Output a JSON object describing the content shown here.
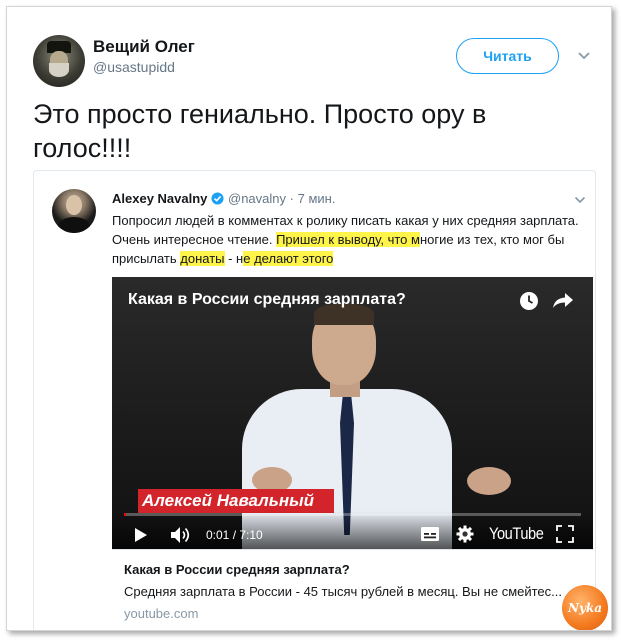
{
  "author": {
    "display_name": "Вещий Олег",
    "handle": "@usastupidd",
    "avatar_icon": "avatar-portrait",
    "follow_label": "Читать"
  },
  "tweet": {
    "text_line1": "Это просто гениально. Просто ору в",
    "text_line2": "голос!!!!"
  },
  "quoted": {
    "name": "Alexey Navalny",
    "handle": "@navalny",
    "separator": "·",
    "time": "7 мин.",
    "text_part1": "Попросил людей в комментах к ролику писать какая у них средняя зарплата. Очень интересное чтение. ",
    "text_hl1": "Пришел к выводу, что м",
    "text_part2": "ногие из тех, кто мог бы присылать ",
    "text_hl2": "донаты",
    "text_part3": " - н",
    "text_hl3": "е делают этого",
    "video": {
      "title": "Какая в России средняя зарплата?",
      "name_plate": "Алексей Навальный",
      "time": "0:01 / 7:10",
      "brand": "YouTube",
      "progress": 0.002
    },
    "card": {
      "title": "Какая в России средняя зарплата?",
      "description": "Средняя зарплата в России - 45 тысяч рублей в месяц. Вы не смейтес...",
      "domain": "youtube.com"
    }
  },
  "watermark": "Nyka",
  "colors": {
    "accent": "#1da1f2",
    "highlight": "#fff44a",
    "name_plate": "#d4242b"
  }
}
